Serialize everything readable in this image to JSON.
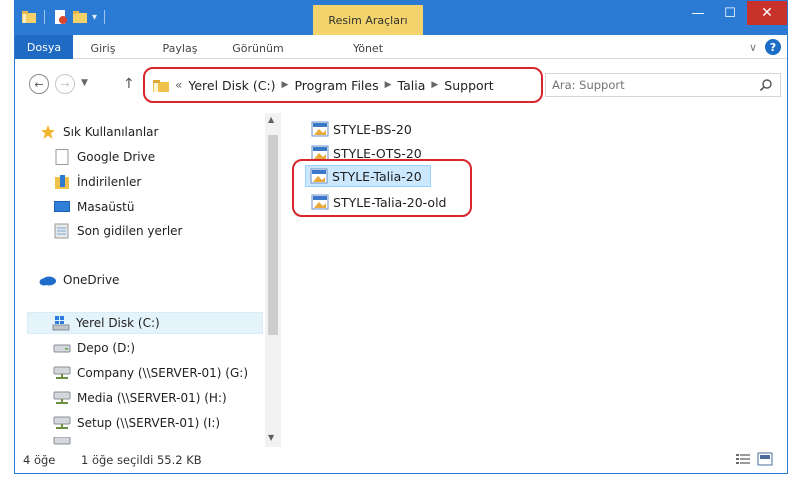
{
  "ribbon": {
    "context_group": "Resim Araçları",
    "tabs": {
      "file": "Dosya",
      "home": "Giriş",
      "share": "Paylaş",
      "view": "Görünüm",
      "manage": "Yönet"
    }
  },
  "titlebar": {
    "minimize": "—",
    "maximize": "☐",
    "close": "✕"
  },
  "address": {
    "overflow": "«",
    "crumbs": [
      "Yerel Disk (C:)",
      "Program Files",
      "Talia",
      "Support"
    ]
  },
  "search": {
    "placeholder": "Ara: Support"
  },
  "navpane": {
    "favorites_header": "Sık Kullanılanlar",
    "favorites": [
      "Google Drive",
      "İndirilenler",
      "Masaüstü",
      "Son gidilen yerler"
    ],
    "onedrive": "OneDrive",
    "drives": [
      "Yerel Disk (C:)",
      "Depo (D:)",
      "Company (\\\\SERVER-01) (G:)",
      "Media (\\\\SERVER-01) (H:)",
      "Setup (\\\\SERVER-01) (I:)"
    ]
  },
  "files": [
    {
      "name": "STYLE-BS-20",
      "selected": false
    },
    {
      "name": "STYLE-OTS-20",
      "selected": false
    },
    {
      "name": "STYLE-Talia-20",
      "selected": true
    },
    {
      "name": "STYLE-Talia-20-old",
      "selected": false
    }
  ],
  "status": {
    "item_count": "4 öğe",
    "selection": "1 öğe seçildi  55.2 KB"
  },
  "colors": {
    "titlebar": "#2b7bd4",
    "context_tab": "#f3d36b",
    "close_button": "#c9322b",
    "highlight_ring": "#d7262d",
    "selection": "#cce8ff"
  }
}
